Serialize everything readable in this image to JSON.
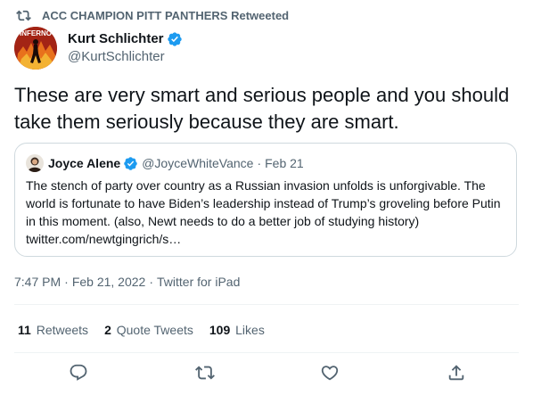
{
  "retweet_banner": {
    "icon": "retweet-icon",
    "text": "ACC CHAMPION PITT PANTHERS Retweeted"
  },
  "author": {
    "avatar_text": "INFERNO",
    "display_name": "Kurt Schlichter",
    "handle": "@KurtSchlichter",
    "verified_icon": "verified-badge-icon"
  },
  "tweet": {
    "text": "These are very smart and serious people and you should take them seriously because they are smart."
  },
  "quoted_tweet": {
    "display_name": "Joyce Alene",
    "handle": "@JoyceWhiteVance",
    "dot": "·",
    "date": "Feb 21",
    "text": "The stench of party over country as a Russian invasion unfolds is unforgivable. The world is fortunate to have Biden’s leadership instead of Trump’s groveling before Putin in this moment. (also, Newt needs to do a better job of studying history) twitter.com/newtgingrich/s…"
  },
  "meta": {
    "time": "7:47 PM",
    "sep1": "·",
    "date": "Feb 21, 2022",
    "sep2": "·",
    "source": "Twitter for iPad"
  },
  "stats": {
    "retweets_count": "11",
    "retweets_label": "Retweets",
    "quotes_count": "2",
    "quotes_label": "Quote Tweets",
    "likes_count": "109",
    "likes_label": "Likes"
  },
  "actions": [
    "reply-icon",
    "retweet-icon",
    "like-icon",
    "share-icon"
  ],
  "colors": {
    "text": "#0f1419",
    "secondary": "#536471",
    "verified": "#1d9bf0",
    "border": "#cfd9de"
  }
}
